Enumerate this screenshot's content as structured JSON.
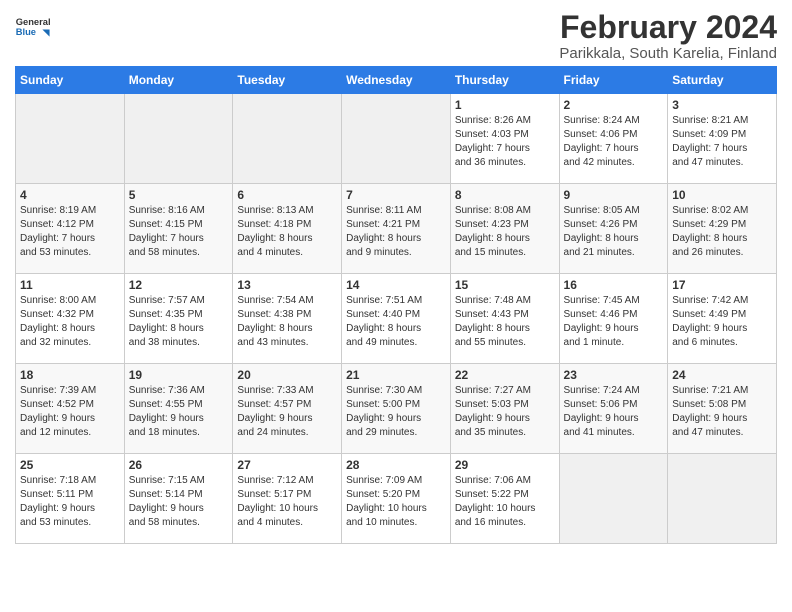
{
  "header": {
    "logo_general": "General",
    "logo_blue": "Blue",
    "month_year": "February 2024",
    "location": "Parikkala, South Karelia, Finland"
  },
  "weekdays": [
    "Sunday",
    "Monday",
    "Tuesday",
    "Wednesday",
    "Thursday",
    "Friday",
    "Saturday"
  ],
  "weeks": [
    [
      {
        "day": "",
        "info": ""
      },
      {
        "day": "",
        "info": ""
      },
      {
        "day": "",
        "info": ""
      },
      {
        "day": "",
        "info": ""
      },
      {
        "day": "1",
        "info": "Sunrise: 8:26 AM\nSunset: 4:03 PM\nDaylight: 7 hours\nand 36 minutes."
      },
      {
        "day": "2",
        "info": "Sunrise: 8:24 AM\nSunset: 4:06 PM\nDaylight: 7 hours\nand 42 minutes."
      },
      {
        "day": "3",
        "info": "Sunrise: 8:21 AM\nSunset: 4:09 PM\nDaylight: 7 hours\nand 47 minutes."
      }
    ],
    [
      {
        "day": "4",
        "info": "Sunrise: 8:19 AM\nSunset: 4:12 PM\nDaylight: 7 hours\nand 53 minutes."
      },
      {
        "day": "5",
        "info": "Sunrise: 8:16 AM\nSunset: 4:15 PM\nDaylight: 7 hours\nand 58 minutes."
      },
      {
        "day": "6",
        "info": "Sunrise: 8:13 AM\nSunset: 4:18 PM\nDaylight: 8 hours\nand 4 minutes."
      },
      {
        "day": "7",
        "info": "Sunrise: 8:11 AM\nSunset: 4:21 PM\nDaylight: 8 hours\nand 9 minutes."
      },
      {
        "day": "8",
        "info": "Sunrise: 8:08 AM\nSunset: 4:23 PM\nDaylight: 8 hours\nand 15 minutes."
      },
      {
        "day": "9",
        "info": "Sunrise: 8:05 AM\nSunset: 4:26 PM\nDaylight: 8 hours\nand 21 minutes."
      },
      {
        "day": "10",
        "info": "Sunrise: 8:02 AM\nSunset: 4:29 PM\nDaylight: 8 hours\nand 26 minutes."
      }
    ],
    [
      {
        "day": "11",
        "info": "Sunrise: 8:00 AM\nSunset: 4:32 PM\nDaylight: 8 hours\nand 32 minutes."
      },
      {
        "day": "12",
        "info": "Sunrise: 7:57 AM\nSunset: 4:35 PM\nDaylight: 8 hours\nand 38 minutes."
      },
      {
        "day": "13",
        "info": "Sunrise: 7:54 AM\nSunset: 4:38 PM\nDaylight: 8 hours\nand 43 minutes."
      },
      {
        "day": "14",
        "info": "Sunrise: 7:51 AM\nSunset: 4:40 PM\nDaylight: 8 hours\nand 49 minutes."
      },
      {
        "day": "15",
        "info": "Sunrise: 7:48 AM\nSunset: 4:43 PM\nDaylight: 8 hours\nand 55 minutes."
      },
      {
        "day": "16",
        "info": "Sunrise: 7:45 AM\nSunset: 4:46 PM\nDaylight: 9 hours\nand 1 minute."
      },
      {
        "day": "17",
        "info": "Sunrise: 7:42 AM\nSunset: 4:49 PM\nDaylight: 9 hours\nand 6 minutes."
      }
    ],
    [
      {
        "day": "18",
        "info": "Sunrise: 7:39 AM\nSunset: 4:52 PM\nDaylight: 9 hours\nand 12 minutes."
      },
      {
        "day": "19",
        "info": "Sunrise: 7:36 AM\nSunset: 4:55 PM\nDaylight: 9 hours\nand 18 minutes."
      },
      {
        "day": "20",
        "info": "Sunrise: 7:33 AM\nSunset: 4:57 PM\nDaylight: 9 hours\nand 24 minutes."
      },
      {
        "day": "21",
        "info": "Sunrise: 7:30 AM\nSunset: 5:00 PM\nDaylight: 9 hours\nand 29 minutes."
      },
      {
        "day": "22",
        "info": "Sunrise: 7:27 AM\nSunset: 5:03 PM\nDaylight: 9 hours\nand 35 minutes."
      },
      {
        "day": "23",
        "info": "Sunrise: 7:24 AM\nSunset: 5:06 PM\nDaylight: 9 hours\nand 41 minutes."
      },
      {
        "day": "24",
        "info": "Sunrise: 7:21 AM\nSunset: 5:08 PM\nDaylight: 9 hours\nand 47 minutes."
      }
    ],
    [
      {
        "day": "25",
        "info": "Sunrise: 7:18 AM\nSunset: 5:11 PM\nDaylight: 9 hours\nand 53 minutes."
      },
      {
        "day": "26",
        "info": "Sunrise: 7:15 AM\nSunset: 5:14 PM\nDaylight: 9 hours\nand 58 minutes."
      },
      {
        "day": "27",
        "info": "Sunrise: 7:12 AM\nSunset: 5:17 PM\nDaylight: 10 hours\nand 4 minutes."
      },
      {
        "day": "28",
        "info": "Sunrise: 7:09 AM\nSunset: 5:20 PM\nDaylight: 10 hours\nand 10 minutes."
      },
      {
        "day": "29",
        "info": "Sunrise: 7:06 AM\nSunset: 5:22 PM\nDaylight: 10 hours\nand 16 minutes."
      },
      {
        "day": "",
        "info": ""
      },
      {
        "day": "",
        "info": ""
      }
    ]
  ]
}
